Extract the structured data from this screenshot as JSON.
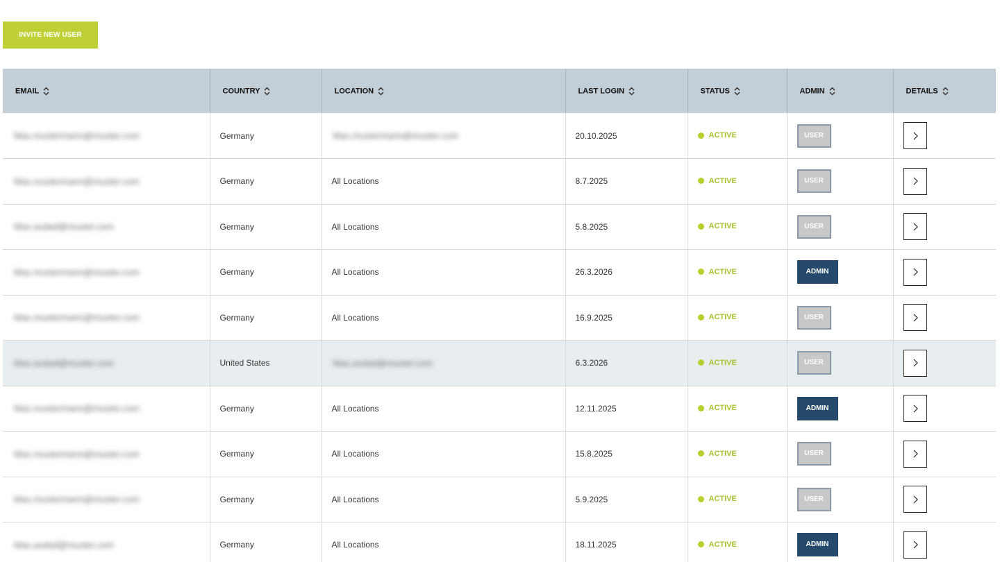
{
  "toolbar": {
    "invite_label": "INVITE NEW USER"
  },
  "table": {
    "headers": {
      "email": "EMAIL",
      "country": "COUNTRY",
      "location": "LOCATION",
      "last_login": "LAST LOGIN",
      "status": "STATUS",
      "admin": "ADMIN",
      "details": "DETAILS"
    },
    "rows": [
      {
        "email": "Max.mustermann@muster.com",
        "country": "Germany",
        "location": "Max.mustermann@muster.com",
        "location_blurred": true,
        "last_login": "20.10.2025",
        "status": "ACTIVE",
        "role": "USER",
        "highlight": false
      },
      {
        "email": "Max.mustermann@muster.com",
        "country": "Germany",
        "location": "All Locations",
        "location_blurred": false,
        "last_login": "8.7.2025",
        "status": "ACTIVE",
        "role": "USER",
        "highlight": false
      },
      {
        "email": "Max.axdad@muster.com",
        "country": "Germany",
        "location": "All Locations",
        "location_blurred": false,
        "last_login": "5.8.2025",
        "status": "ACTIVE",
        "role": "USER",
        "highlight": false
      },
      {
        "email": "Max.mustermann@muster.com",
        "country": "Germany",
        "location": "All Locations",
        "location_blurred": false,
        "last_login": "26.3.2026",
        "status": "ACTIVE",
        "role": "ADMIN",
        "highlight": false
      },
      {
        "email": "Max.mustermann@muster.com",
        "country": "Germany",
        "location": "All Locations",
        "location_blurred": false,
        "last_login": "16.9.2025",
        "status": "ACTIVE",
        "role": "USER",
        "highlight": false
      },
      {
        "email": "Max.axdad@muster.com",
        "country": "United States",
        "location": "Max.axdad@muster.com",
        "location_blurred": true,
        "last_login": "6.3.2026",
        "status": "ACTIVE",
        "role": "USER",
        "highlight": true
      },
      {
        "email": "Max.mustermann@muster.com",
        "country": "Germany",
        "location": "All Locations",
        "location_blurred": false,
        "last_login": "12.11.2025",
        "status": "ACTIVE",
        "role": "ADMIN",
        "highlight": false
      },
      {
        "email": "Max.mustermann@muster.com",
        "country": "Germany",
        "location": "All Locations",
        "location_blurred": false,
        "last_login": "15.8.2025",
        "status": "ACTIVE",
        "role": "USER",
        "highlight": false
      },
      {
        "email": "Max.mustermann@muster.com",
        "country": "Germany",
        "location": "All Locations",
        "location_blurred": false,
        "last_login": "5.9.2025",
        "status": "ACTIVE",
        "role": "USER",
        "highlight": false
      },
      {
        "email": "Max.axdad@muster.com",
        "country": "Germany",
        "location": "All Locations",
        "location_blurred": false,
        "last_login": "18.11.2025",
        "status": "ACTIVE",
        "role": "ADMIN",
        "highlight": false
      }
    ]
  },
  "colors": {
    "accent": "#bfcf36",
    "header_bg": "#c3ced6",
    "status_active": "#a5c22b",
    "admin_badge": "#24496b",
    "user_badge": "#c6c8ca",
    "highlight_row": "#e8edf0"
  },
  "icons": {
    "sort": "sort-updown-icon",
    "details": "chevron-right-icon",
    "status": "status-dot-icon"
  }
}
